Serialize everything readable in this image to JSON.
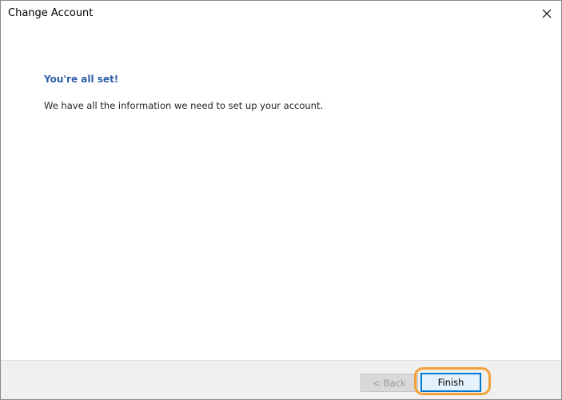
{
  "window": {
    "title": "Change Account"
  },
  "content": {
    "heading": "You're all set!",
    "message": "We have all the information we need to set up your account."
  },
  "footer": {
    "back_label": "< Back",
    "finish_label": "Finish"
  },
  "icons": {
    "close": "close-icon"
  },
  "colors": {
    "heading": "#2e5ea8",
    "primary_button_border": "#0078d7",
    "highlight_ring": "#f2a03a",
    "footer_bg": "#f0f0f0"
  }
}
